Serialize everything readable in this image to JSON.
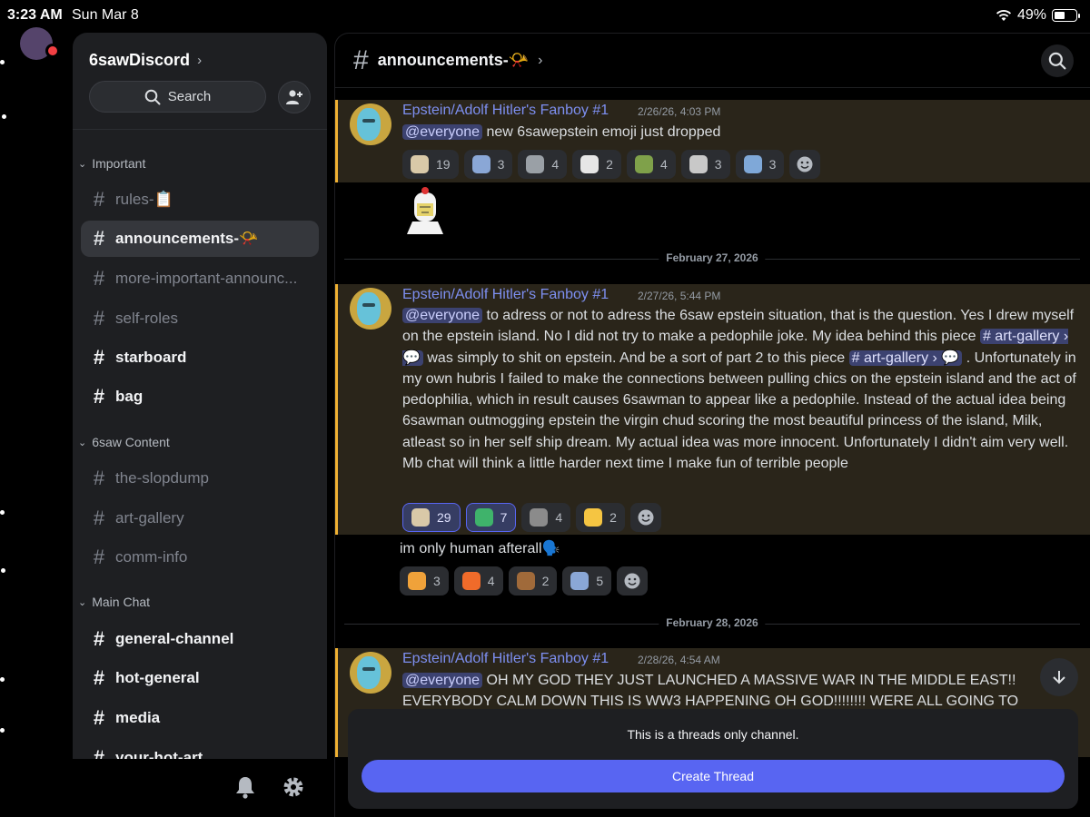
{
  "status_bar": {
    "time": "3:23 AM",
    "date": "Sun Mar 8",
    "battery": "49%",
    "battery_level": 0.49
  },
  "server": {
    "name": "6sawDiscord",
    "chevron": "›"
  },
  "sidebar": {
    "search_label": "Search",
    "categories": [
      {
        "label": "Important"
      },
      {
        "label": "6saw Content"
      },
      {
        "label": "Main Chat"
      }
    ],
    "channels": [
      {
        "name": "rules-📋"
      },
      {
        "name": "announcements-📯"
      },
      {
        "name": "more-important-announc..."
      },
      {
        "name": "self-roles"
      },
      {
        "name": "starboard"
      },
      {
        "name": "bag"
      },
      {
        "name": "the-slopdump"
      },
      {
        "name": "art-gallery"
      },
      {
        "name": "comm-info"
      },
      {
        "name": "general-channel"
      },
      {
        "name": "hot-general"
      },
      {
        "name": "media"
      },
      {
        "name": "your-hot-art"
      }
    ]
  },
  "header": {
    "title": "announcements-📯",
    "chevron": "›"
  },
  "messages": [
    {
      "author": "Epstein/Adolf Hitler's Fanboy #1",
      "timestamp": "2/26/26, 4:03 PM",
      "mention": "@everyone",
      "text": " new 6sawepstein emoji just dropped",
      "reactions": [
        {
          "count": "19",
          "color": "#d9c9a8"
        },
        {
          "count": "3",
          "color": "#8aa7d6"
        },
        {
          "count": "4",
          "color": "#9aa0a6"
        },
        {
          "count": "2",
          "color": "#e6e6e6"
        },
        {
          "count": "4",
          "color": "#7fa14a"
        },
        {
          "count": "3",
          "color": "#c8c8c8"
        },
        {
          "count": "3",
          "color": "#7fa8d8"
        }
      ]
    },
    {
      "author": "Epstein/Adolf Hitler's Fanboy #1",
      "timestamp": "2/27/26, 5:44 PM",
      "mention": "@everyone",
      "text_1": " to adress or not to adress the 6saw epstein situation, that is the question. Yes I drew myself on the epstein island. No I did not try to make a pedophile joke. My idea behind this piece ",
      "link_1": "# art-gallery › 💬",
      "text_2": " was simply to shit on epstein. And be a sort of part 2 to this piece ",
      "link_2": "# art-gallery › 💬",
      "text_3": " . Unfortunately in my own hubris I failed to make the connections between pulling chics on the epstein island and the act of pedophilia, which in result causes 6sawman to appear like a pedophile. Instead of the actual idea being 6sawman outmogging epstein the virgin chud scoring the most beautiful princess of the island, Milk, atleast so in her self ship dream. My actual idea was more innocent. Unfortunately I didn't aim very well. Mb chat will think a little harder next time I make fun of terrible people",
      "reactions": [
        {
          "count": "29",
          "color": "#d9c9a8"
        },
        {
          "count": "7",
          "color": "#3fb36b"
        },
        {
          "count": "4",
          "color": "#8b8b8b"
        },
        {
          "count": "2",
          "color": "#f5c542"
        }
      ],
      "followup": "im only human afterall🗣️",
      "followup_reactions": [
        {
          "count": "3",
          "color": "#f0a23a"
        },
        {
          "count": "4",
          "color": "#f06b2a"
        },
        {
          "count": "2",
          "color": "#a06a3a"
        },
        {
          "count": "5",
          "color": "#8aa7d6"
        }
      ]
    },
    {
      "author": "Epstein/Adolf Hitler's Fanboy #1",
      "timestamp": "2/28/26, 4:54 AM",
      "mention": "@everyone",
      "text": " OH MY GOD THEY JUST LAUNCHED A MASSIVE WAR IN THE MIDDLE EAST!! EVERYBODY CALM DOWN THIS IS WW3 HAPPENING OH GOD!!!!!!!! WERE ALL GOING TO DIEEE"
    }
  ],
  "date_dividers": [
    "February 27, 2026",
    "February 28, 2026"
  ],
  "threads_panel": {
    "notice": "This is a threads only channel.",
    "button": "Create Thread"
  },
  "colors": {
    "accent": "#5865f2",
    "mention_bg": "#2a251a",
    "mention_bar": "#f0b132",
    "author": "#7d8ff0"
  },
  "icons": [
    "search-icon",
    "add-member-icon",
    "bell-icon",
    "gear-icon",
    "hash-icon",
    "chevron-down-icon",
    "add-reaction-icon",
    "arrow-down-icon",
    "wifi-icon",
    "battery-icon"
  ]
}
